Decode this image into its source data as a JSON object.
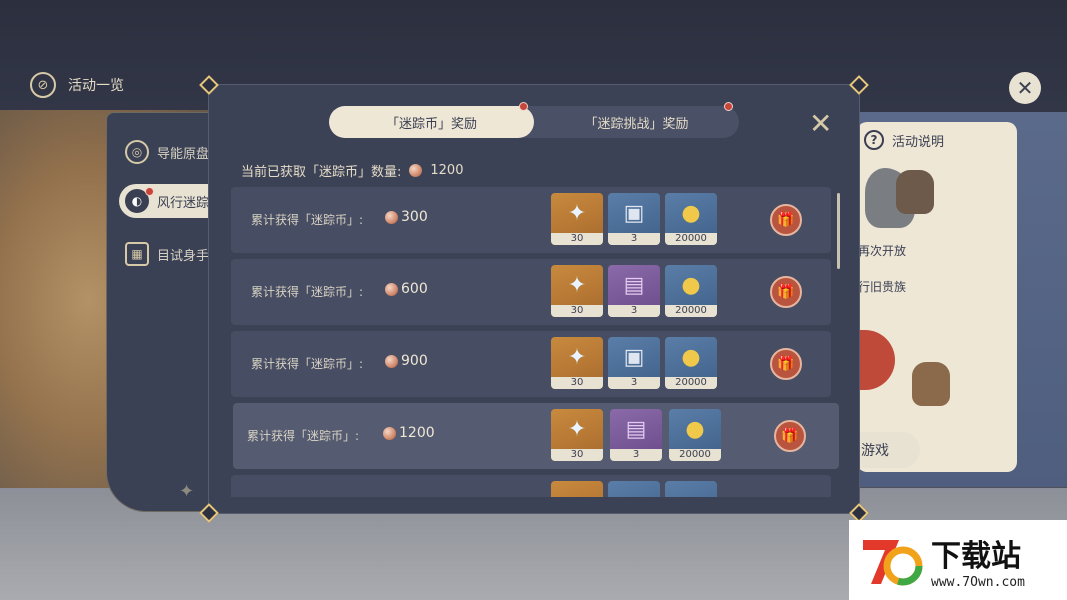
{
  "top_bar": {
    "activity_list_label": "活动一览"
  },
  "side_nav": {
    "items": [
      {
        "label": "导能原盘"
      },
      {
        "label": "风行迷踪"
      },
      {
        "label": "目试身手"
      }
    ]
  },
  "right_panel": {
    "help_label": "活动说明",
    "text_reopen": "再次开放",
    "text_old": "行旧贵族",
    "play_button": "游戏"
  },
  "dialog": {
    "tabs": [
      {
        "label": "「迷踪币」奖励",
        "active": true
      },
      {
        "label": "「迷踪挑战」奖励",
        "active": false
      }
    ],
    "close_symbol": "✕",
    "coin_count_label": "当前已获取「迷踪币」数量:",
    "coin_count_value": "1200",
    "rows": [
      {
        "label": "累计获得「迷踪币」:",
        "amount": "300",
        "rewards": [
          {
            "icon": "primogem-icon",
            "qty": "30",
            "color": "orange"
          },
          {
            "icon": "hero-wit-icon",
            "qty": "3",
            "color": "blue"
          },
          {
            "icon": "mora-icon",
            "qty": "20000",
            "color": "blue"
          }
        ]
      },
      {
        "label": "累计获得「迷踪币」:",
        "amount": "600",
        "rewards": [
          {
            "icon": "primogem-icon",
            "qty": "30",
            "color": "orange"
          },
          {
            "icon": "talent-book-icon",
            "qty": "3",
            "color": "purple"
          },
          {
            "icon": "mora-icon",
            "qty": "20000",
            "color": "blue"
          }
        ]
      },
      {
        "label": "累计获得「迷踪币」:",
        "amount": "900",
        "rewards": [
          {
            "icon": "primogem-icon",
            "qty": "30",
            "color": "orange"
          },
          {
            "icon": "hero-wit-icon",
            "qty": "3",
            "color": "blue"
          },
          {
            "icon": "mora-icon",
            "qty": "20000",
            "color": "blue"
          }
        ]
      },
      {
        "label": "累计获得「迷踪币」:",
        "amount": "1200",
        "rewards": [
          {
            "icon": "primogem-icon",
            "qty": "30",
            "color": "orange"
          },
          {
            "icon": "talent-book-icon",
            "qty": "3",
            "color": "purple"
          },
          {
            "icon": "mora-icon",
            "qty": "20000",
            "color": "blue"
          }
        ]
      }
    ]
  },
  "watermark": {
    "title": "下载站",
    "url": "www.7Own.com"
  },
  "colors": {
    "dialog_bg": "#3c4255",
    "tab_active_bg": "#efe7d6",
    "gift_button": "#b9543f",
    "accent_gold": "#e6c77a"
  }
}
